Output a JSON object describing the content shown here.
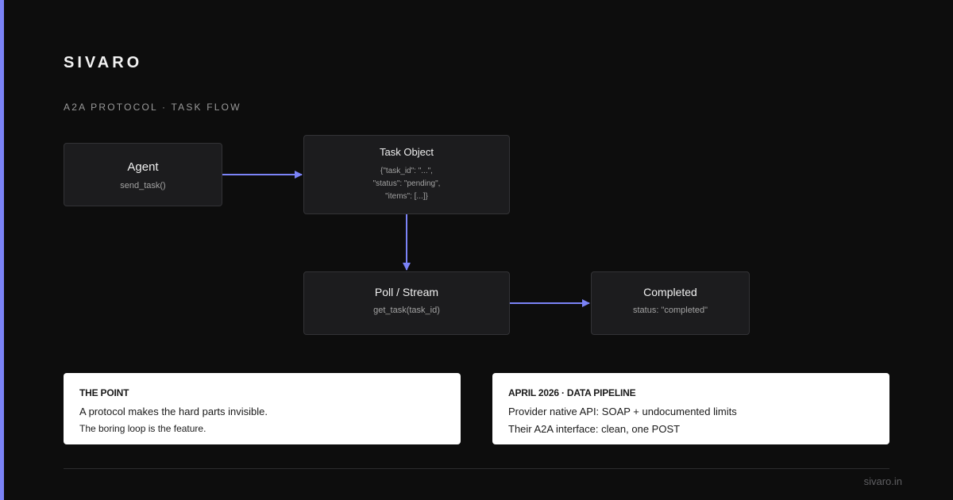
{
  "theme": {
    "accent": "#7b83f7",
    "background": "#0d0d0d",
    "node_fill": "#1c1c1e",
    "card_fill": "#ffffff"
  },
  "brand": "SIVARO",
  "subtitle": "A2A PROTOCOL · TASK FLOW",
  "diagram": {
    "nodes": {
      "agent": {
        "title": "Agent",
        "sub": "send_task()"
      },
      "task": {
        "title": "Task Object",
        "code": [
          "{\"task_id\": \"...\",",
          "\"status\": \"pending\",",
          "\"items\": [...]}"
        ]
      },
      "poll": {
        "title": "Poll / Stream",
        "sub": "get_task(task_id)"
      },
      "done": {
        "title": "Completed",
        "sub": "status: \"completed\""
      }
    },
    "edges": [
      {
        "from": "agent",
        "to": "task"
      },
      {
        "from": "task",
        "to": "poll"
      },
      {
        "from": "poll",
        "to": "done"
      }
    ]
  },
  "cards": {
    "point": {
      "heading": "THE POINT",
      "line1": "A protocol makes the hard parts invisible.",
      "line2": "The boring loop is the feature."
    },
    "pipeline": {
      "heading": "APRIL 2026 · DATA PIPELINE",
      "line1": "Provider native API: SOAP + undocumented limits",
      "line2": "Their A2A interface: clean, one POST"
    }
  },
  "footer": "sivaro.in"
}
